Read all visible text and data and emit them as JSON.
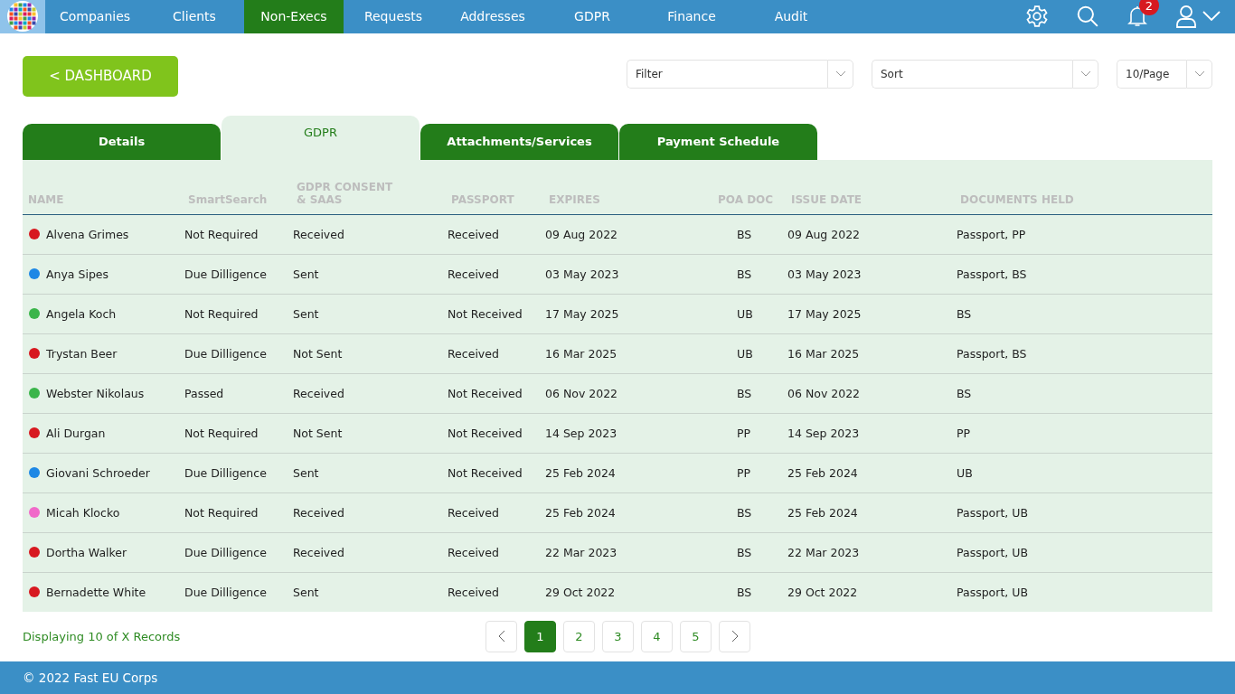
{
  "nav": {
    "items": [
      {
        "label": "Companies",
        "selected": false
      },
      {
        "label": "Clients",
        "selected": false
      },
      {
        "label": "Non-Execs",
        "selected": true
      },
      {
        "label": "Requests",
        "selected": false
      },
      {
        "label": "Addresses",
        "selected": false
      },
      {
        "label": "GDPR",
        "selected": false
      },
      {
        "label": "Finance",
        "selected": false
      },
      {
        "label": "Audit",
        "selected": false
      }
    ],
    "notification_count": "2"
  },
  "back_button": "< DASHBOARD",
  "filters": [
    {
      "placeholder": "Filter",
      "kind": "wide"
    },
    {
      "placeholder": "Sort",
      "kind": "wide"
    },
    {
      "placeholder": "10/Page",
      "kind": "narrow"
    }
  ],
  "tabs": [
    {
      "label": "Details",
      "selected": false
    },
    {
      "label": "GDPR",
      "selected": true
    },
    {
      "label": "Attachments/Services",
      "selected": false
    },
    {
      "label": "Payment Schedule",
      "selected": false
    }
  ],
  "table": {
    "columns": [
      "NAME",
      "SmartSearch",
      "GDPR CONSENT & SAAS",
      "PASSPORT",
      "EXPIRES",
      "POA DOC",
      "ISSUE DATE",
      "DOCUMENTS HELD"
    ],
    "rows": [
      {
        "color": "#d71920",
        "cells": [
          "Alvena Grimes",
          "Not Required",
          "Received",
          "Received",
          "09 Aug 2022",
          "BS",
          "09 Aug 2022",
          "Passport, PP"
        ]
      },
      {
        "color": "#1e88e5",
        "cells": [
          "Anya Sipes",
          "Due Dilligence",
          "Sent",
          "Received",
          "03 May 2023",
          "BS",
          "03 May 2023",
          "Passport, BS"
        ]
      },
      {
        "color": "#3ab54a",
        "cells": [
          "Angela Koch",
          "Not Required",
          "Sent",
          "Not Received",
          "17 May 2025",
          "UB",
          "17 May 2025",
          "BS"
        ]
      },
      {
        "color": "#d71920",
        "cells": [
          "Trystan Beer",
          "Due Dilligence",
          "Not Sent",
          "Received",
          "16 Mar 2025",
          "UB",
          "16 Mar 2025",
          "Passport, BS"
        ]
      },
      {
        "color": "#3ab54a",
        "cells": [
          "Webster Nikolaus",
          "Passed",
          "Received",
          "Not Received",
          "06 Nov 2022",
          "BS",
          "06 Nov 2022",
          "BS"
        ]
      },
      {
        "color": "#d71920",
        "cells": [
          "Ali Durgan",
          "Not Required",
          "Not Sent",
          "Not Received",
          "14 Sep 2023",
          "PP",
          "14 Sep 2023",
          "PP"
        ]
      },
      {
        "color": "#1e88e5",
        "cells": [
          "Giovani Schroeder",
          "Due Dilligence",
          "Sent",
          "Not Received",
          "25 Feb 2024",
          "PP",
          "25 Feb 2024",
          "UB"
        ]
      },
      {
        "color": "#f06ac9",
        "cells": [
          "Micah Klocko",
          "Not Required",
          "Received",
          "Received",
          "25 Feb 2024",
          "BS",
          "25 Feb 2024",
          "Passport, UB"
        ]
      },
      {
        "color": "#d71920",
        "cells": [
          "Dortha Walker",
          "Due Dilligence",
          "Received",
          "Received",
          "22 Mar 2023",
          "BS",
          "22 Mar 2023",
          "Passport, UB"
        ]
      },
      {
        "color": "#d71920",
        "cells": [
          "Bernadette White",
          "Due Dilligence",
          "Sent",
          "Received",
          "29 Oct 2022",
          "BS",
          "29 Oct 2022",
          "Passport, UB"
        ]
      }
    ]
  },
  "record_count": "Displaying 10 of X Records",
  "pagination": [
    {
      "label": "1",
      "selected": true
    },
    {
      "label": "2",
      "selected": false
    },
    {
      "label": "3",
      "selected": false
    },
    {
      "label": "4",
      "selected": false
    },
    {
      "label": "5",
      "selected": false
    }
  ],
  "footer": "© 2022 Fast EU Corps"
}
